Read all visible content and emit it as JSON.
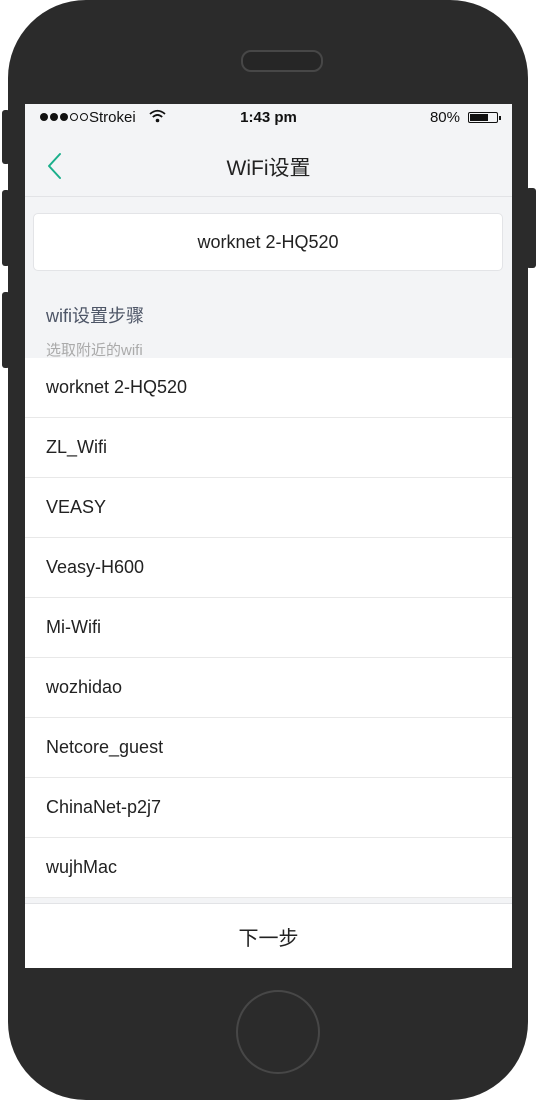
{
  "status_bar": {
    "carrier": "Strokei",
    "time": "1:43 pm",
    "battery": "80%",
    "battery_level": 0.8,
    "signal_bars_filled": 3,
    "signal_bars_total": 5
  },
  "navbar": {
    "back_icon": "chevron-left-icon",
    "title": "WiFi设置"
  },
  "selected_network": "worknet 2-HQ520",
  "steps": {
    "title": "wifi设置步骤",
    "subtitle": "选取附近的wifi"
  },
  "wifi_list": [
    "worknet 2-HQ520",
    "ZL_Wifi",
    "VEASY",
    "Veasy-H600",
    "Mi-Wifi",
    "wozhidao",
    "Netcore_guest",
    "ChinaNet-p2j7",
    "wujhMac"
  ],
  "next_button": "下一步",
  "colors": {
    "accent": "#1aaf8b",
    "phone_frame": "#2b2b2b",
    "screen_bg": "#f3f4f6",
    "steps_title": "#4d5566"
  }
}
